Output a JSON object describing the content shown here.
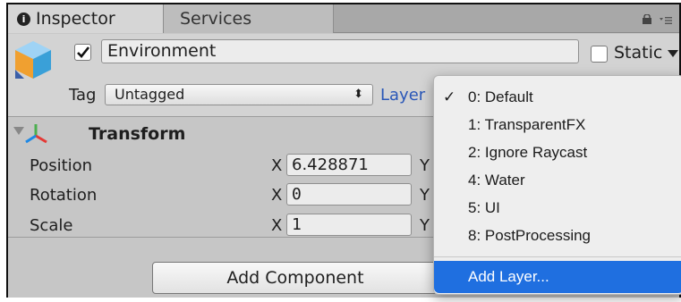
{
  "tabs": [
    {
      "label": "Inspector",
      "icon": "info-icon",
      "active": true
    },
    {
      "label": "Services",
      "active": false
    }
  ],
  "header": {
    "object_active": true,
    "object_name": "Environment",
    "static_label": "Static",
    "static_checked": false,
    "tag_label": "Tag",
    "tag_value": "Untagged",
    "layer_label": "Layer"
  },
  "transform": {
    "title": "Transform",
    "rows": [
      {
        "label": "Position",
        "x_axis": "X",
        "x_value": "6.428871",
        "y_axis": "Y"
      },
      {
        "label": "Rotation",
        "x_axis": "X",
        "x_value": "0",
        "y_axis": "Y"
      },
      {
        "label": "Scale",
        "x_axis": "X",
        "x_value": "1",
        "y_axis": "Y"
      }
    ]
  },
  "add_component_label": "Add Component",
  "layer_menu": {
    "items": [
      {
        "label": "0: Default",
        "checked": true
      },
      {
        "label": "1: TransparentFX",
        "checked": false
      },
      {
        "label": "2: Ignore Raycast",
        "checked": false
      },
      {
        "label": "4: Water",
        "checked": false
      },
      {
        "label": "5: UI",
        "checked": false
      },
      {
        "label": "8: PostProcessing",
        "checked": false
      }
    ],
    "check_glyph": "✓",
    "add_layer_label": "Add Layer...",
    "highlight_color": "#1f6fe0"
  },
  "colors": {
    "layer_label": "#2a57b8",
    "panel_bg": "#c6c6c6"
  }
}
